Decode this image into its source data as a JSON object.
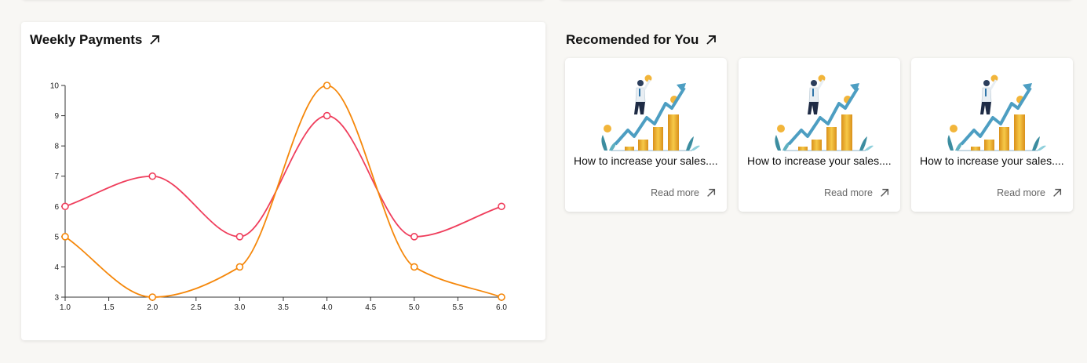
{
  "weekly_payments": {
    "title": "Weekly Payments"
  },
  "recommended": {
    "title": "Recomended for You",
    "cards": [
      {
        "text": "How to increase your sales....",
        "read_more": "Read more"
      },
      {
        "text": "How to increase your sales....",
        "read_more": "Read more"
      },
      {
        "text": "How to increase your sales....",
        "read_more": "Read more"
      }
    ]
  },
  "chart_data": {
    "type": "line",
    "title": "",
    "xlabel": "",
    "ylabel": "",
    "xlim": [
      1.0,
      6.0
    ],
    "ylim": [
      3,
      10
    ],
    "xticks": [
      1.0,
      1.5,
      2.0,
      2.5,
      3.0,
      3.5,
      4.0,
      4.5,
      5.0,
      5.5,
      6.0
    ],
    "yticks": [
      3,
      4,
      5,
      6,
      7,
      8,
      9,
      10
    ],
    "x": [
      1,
      2,
      3,
      4,
      5,
      6
    ],
    "series": [
      {
        "values": [
          6,
          7,
          5,
          9,
          5,
          6
        ],
        "color": "#ef3e5c"
      },
      {
        "values": [
          5,
          3,
          4,
          10,
          4,
          3
        ],
        "color": "#f5870a"
      }
    ],
    "grid": false,
    "legend": "none"
  }
}
